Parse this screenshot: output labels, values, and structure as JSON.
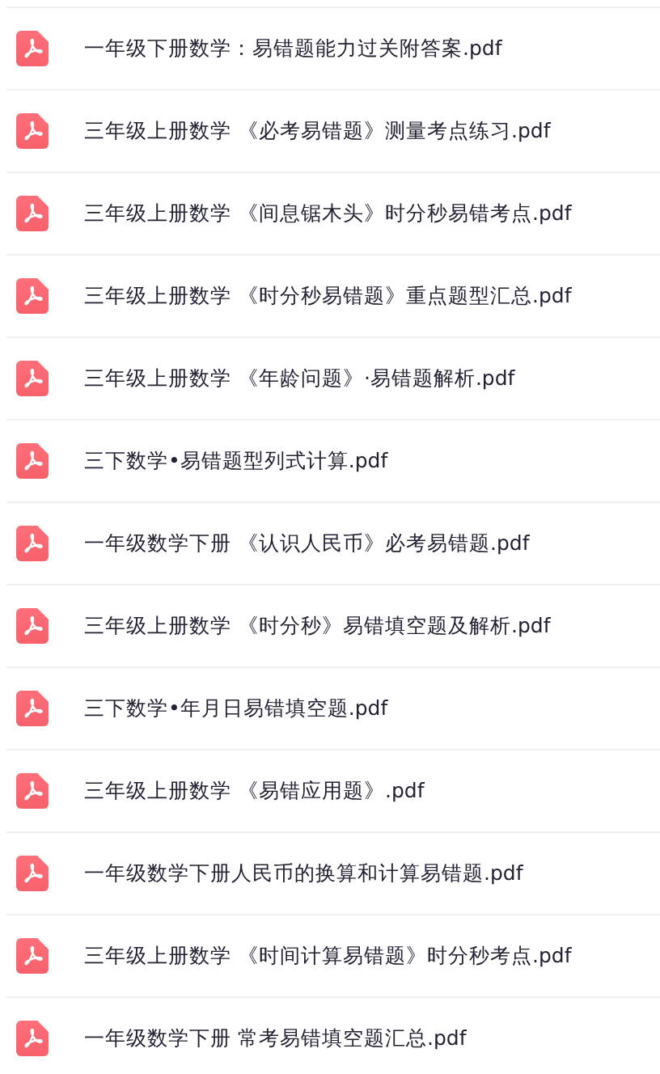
{
  "files": [
    {
      "name": "一年级下册数学：易错题能力过关附答案.pdf"
    },
    {
      "name": "三年级上册数学 《必考易错题》测量考点练习.pdf"
    },
    {
      "name": "三年级上册数学 《间息锯木头》时分秒易错考点.pdf"
    },
    {
      "name": "三年级上册数学 《时分秒易错题》重点题型汇总.pdf"
    },
    {
      "name": "三年级上册数学 《年龄问题》·易错题解析.pdf"
    },
    {
      "name": "三下数学•易错题型列式计算.pdf"
    },
    {
      "name": "一年级数学下册 《认识人民币》必考易错题.pdf"
    },
    {
      "name": "三年级上册数学 《时分秒》易错填空题及解析.pdf"
    },
    {
      "name": "三下数学•年月日易错填空题.pdf"
    },
    {
      "name": "三年级上册数学 《易错应用题》.pdf"
    },
    {
      "name": "一年级数学下册人民币的换算和计算易错题.pdf"
    },
    {
      "name": "三年级上册数学 《时间计算易错题》时分秒考点.pdf"
    },
    {
      "name": "一年级数学下册 常考易错填空题汇总.pdf"
    }
  ]
}
